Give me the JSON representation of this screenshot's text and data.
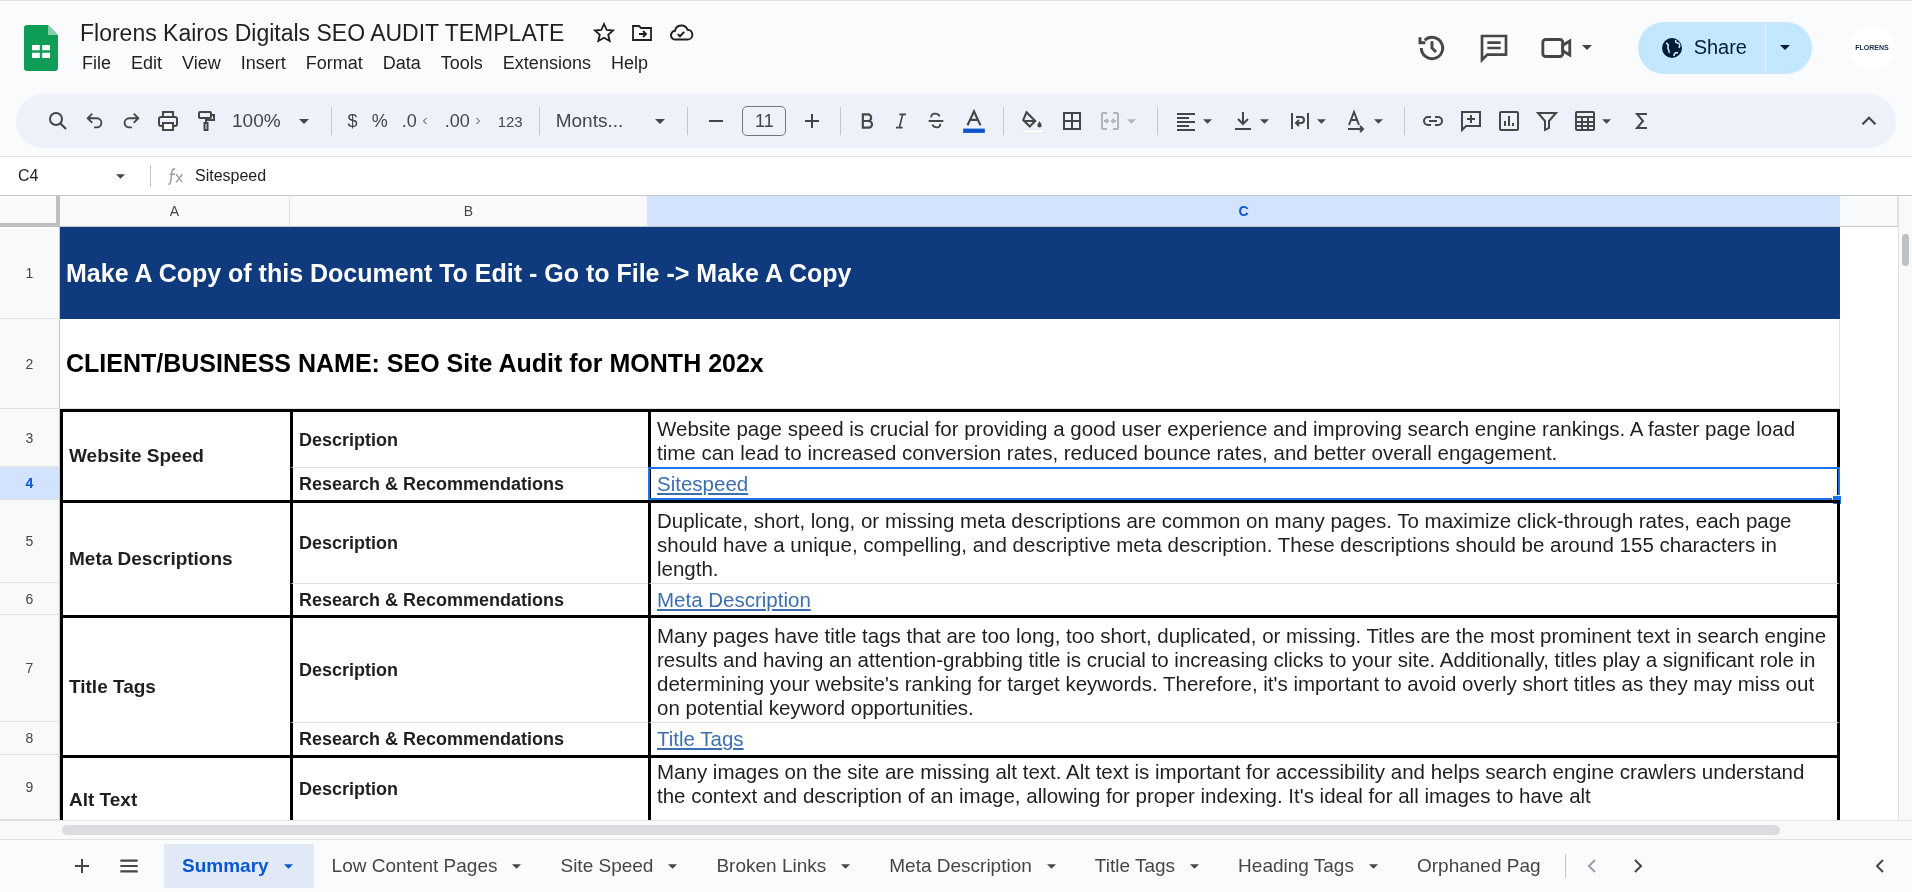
{
  "document": {
    "title": "Florens Kairos Digitals SEO AUDIT TEMPLATE",
    "menu": [
      "File",
      "Edit",
      "View",
      "Insert",
      "Format",
      "Data",
      "Tools",
      "Extensions",
      "Help"
    ]
  },
  "share_button": {
    "label": "Share"
  },
  "account_avatar": {
    "text": "FLORENS"
  },
  "toolbar": {
    "zoom": "100%",
    "currency_format": "$",
    "percent_format": "%",
    "decrease_decimal": ".0",
    "increase_decimal": ".00",
    "more_formats": "123",
    "font_family": "Monts...",
    "font_size": "11"
  },
  "formula_bar": {
    "cell_ref": "C4",
    "value": "Sitespeed"
  },
  "columns": [
    {
      "label": "A",
      "selected": false
    },
    {
      "label": "B",
      "selected": false
    },
    {
      "label": "C",
      "selected": true
    }
  ],
  "rows": [
    {
      "number": "1",
      "selected": false
    },
    {
      "number": "2",
      "selected": false
    },
    {
      "number": "3",
      "selected": false
    },
    {
      "number": "4",
      "selected": true
    },
    {
      "number": "5",
      "selected": false
    },
    {
      "number": "6",
      "selected": false
    },
    {
      "number": "7",
      "selected": false
    },
    {
      "number": "8",
      "selected": false
    },
    {
      "number": "9",
      "selected": false
    }
  ],
  "banner": "Make A Copy of this Document To Edit - Go to File -> Make A Copy",
  "client_heading": "CLIENT/BUSINESS NAME: SEO Site Audit for MONTH 202x",
  "sections": [
    {
      "name": "Website Speed",
      "description_label": "Description",
      "description": "Website page speed is crucial for providing a good user experience and improving search engine rankings. A faster page load time can lead to increased conversion rates, reduced bounce rates, and better overall engagement.",
      "research_label": "Research & Recommendations",
      "link": "Sitespeed",
      "research_selected": true
    },
    {
      "name": "Meta Descriptions",
      "description_label": "Description",
      "description": "Duplicate, short, long, or missing meta descriptions are common on many pages. To maximize click-through rates, each page should have a unique, compelling, and descriptive meta description. These descriptions should be around 155 characters in length.",
      "research_label": "Research & Recommendations",
      "link": "Meta Description",
      "research_selected": false
    },
    {
      "name": "Title Tags",
      "description_label": "Description",
      "description": "Many pages have title tags that are too long, too short, duplicated, or missing. Titles are the most prominent text in search engine results and having an attention-grabbing title is crucial to increasing clicks to your site. Additionally, titles play a significant role in determining your website's ranking for target keywords. Therefore, it's important to avoid overly short titles as they may miss out on potential keyword opportunities.",
      "research_label": "Research & Recommendations",
      "link": "Title Tags",
      "research_selected": false
    },
    {
      "name": "Alt Text",
      "description_label": "Description",
      "description": "Many images on the site are missing alt text. Alt text is important for accessibility and helps search engine crawlers understand the context and description of an image, allowing for proper indexing. It's ideal for all images to have alt"
    }
  ],
  "sheet_tabs": [
    {
      "label": "Summary",
      "selected": true,
      "menu": true
    },
    {
      "label": "Low Content Pages",
      "selected": false,
      "menu": true
    },
    {
      "label": "Site Speed",
      "selected": false,
      "menu": true
    },
    {
      "label": "Broken Links",
      "selected": false,
      "menu": true
    },
    {
      "label": "Meta Description",
      "selected": false,
      "menu": true
    },
    {
      "label": "Title Tags",
      "selected": false,
      "menu": true
    },
    {
      "label": "Heading Tags",
      "selected": false,
      "menu": true
    },
    {
      "label": "Orphaned Pag",
      "selected": false,
      "menu": false
    }
  ]
}
